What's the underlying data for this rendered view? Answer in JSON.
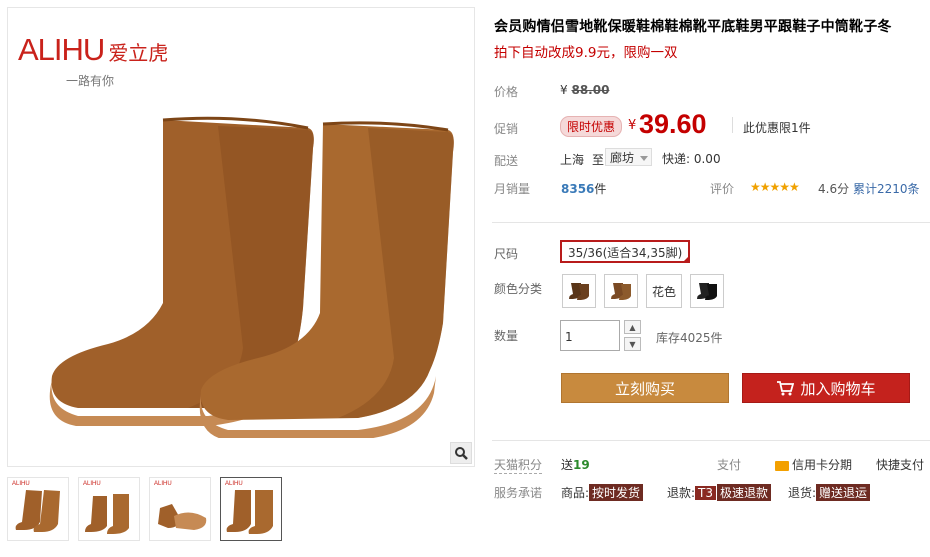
{
  "brand": {
    "name_en": "ALIHU",
    "name_cn": "爱立虎",
    "slogan": "一路有你"
  },
  "thumb_brand": "ALIHU",
  "product": {
    "title": "会员购情侣雪地靴保暖鞋棉鞋棉靴平底鞋男平跟鞋子中筒靴子冬",
    "subtitle": "拍下自动改成9.9元，限购一双"
  },
  "price": {
    "label": "价格",
    "yen": "¥",
    "original": "88.00",
    "promo_label": "促销",
    "promo_tag": "限时优惠",
    "promo_price": "39.60",
    "limit_text": "此优惠限1件"
  },
  "shipping": {
    "label": "配送",
    "from": "上海",
    "to_word": "至",
    "dest": "廊坊",
    "express": "快递: 0.00"
  },
  "sales": {
    "label": "月销量",
    "count": "8356",
    "unit": "件",
    "rating_label": "评价",
    "stars": "★★★★★",
    "score": "4.6分",
    "reviews": "累计2210条"
  },
  "options": {
    "size_label": "尺码",
    "size_value": "35/36(适合34,35脚)",
    "color_label": "颜色分类",
    "color_text_option": "花色",
    "qty_label": "数量",
    "qty_value": "1",
    "stock": "库存4025件"
  },
  "buttons": {
    "buy": "立刻购买",
    "cart": "加入购物车"
  },
  "footer": {
    "points_label": "天猫积分",
    "points_send": "送",
    "points_value": "19",
    "pay_label": "支付",
    "credit": "信用卡分期",
    "fastpay": "快捷支付",
    "service_label": "服务承诺",
    "goods_label": "商品:",
    "goods_badge": "按时发货",
    "refund_label": "退款:",
    "refund_t3": "T3",
    "refund_badge": "极速退款",
    "return_label": "退货:",
    "return_badge": "赠送退运"
  },
  "colors": {
    "accent": "#c40000",
    "buy_button": "#c88a3e",
    "cart_button": "#c4221d",
    "boot": "#a0602a"
  }
}
